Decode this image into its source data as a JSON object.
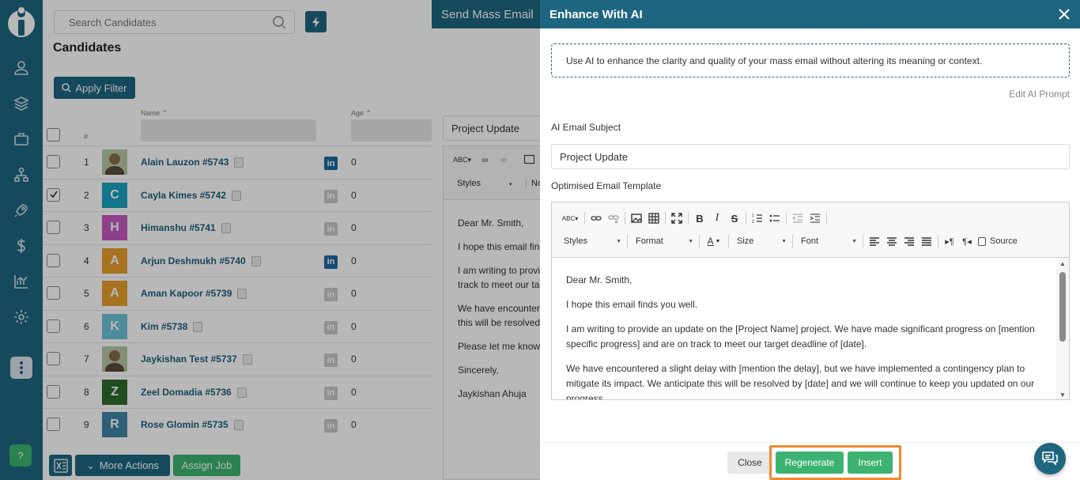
{
  "colors": {
    "primary": "#1e6680",
    "success": "#3cb371",
    "highlight": "#f08a30"
  },
  "rail": {
    "icons": [
      "logo-icon",
      "person-icon",
      "layers-icon",
      "briefcase-icon",
      "org-chart-icon",
      "rocket-icon",
      "dollar-icon",
      "chart-icon",
      "gear-icon",
      "more-icon",
      "help-icon"
    ],
    "help_label": "?"
  },
  "candidates": {
    "search_placeholder": "Search Candidates",
    "title": "Candidates",
    "apply_filter": "Apply Filter",
    "col_name": "Name",
    "col_age": "Age",
    "col_num": "#",
    "rows": [
      {
        "num": "1",
        "name": "Alain Lauzon #5743",
        "avatar": "",
        "avatar_color": "photo",
        "linkedin": true,
        "age": "0",
        "checked": false
      },
      {
        "num": "2",
        "name": "Cayla Kimes #5742",
        "avatar": "C",
        "avatar_color": "#1aa3c0",
        "linkedin": false,
        "age": "0",
        "checked": true
      },
      {
        "num": "3",
        "name": "Himanshu #5741",
        "avatar": "H",
        "avatar_color": "#c659c0",
        "linkedin": false,
        "age": "0",
        "checked": false
      },
      {
        "num": "4",
        "name": "Arjun Deshmukh #5740",
        "avatar": "A",
        "avatar_color": "#e8a02e",
        "linkedin": true,
        "age": "0",
        "checked": false
      },
      {
        "num": "5",
        "name": "Aman Kapoor #5739",
        "avatar": "A",
        "avatar_color": "#e8a02e",
        "linkedin": false,
        "age": "0",
        "checked": false
      },
      {
        "num": "6",
        "name": "Kim #5738",
        "avatar": "K",
        "avatar_color": "#6cc3d8",
        "linkedin": false,
        "age": "0",
        "checked": false
      },
      {
        "num": "7",
        "name": "Jaykishan Test #5737",
        "avatar": "",
        "avatar_color": "photo",
        "linkedin": false,
        "age": "0",
        "checked": false
      },
      {
        "num": "8",
        "name": "Zeel Domadia #5736",
        "avatar": "Z",
        "avatar_color": "#2e6b2e",
        "linkedin": false,
        "age": "0",
        "checked": false
      },
      {
        "num": "9",
        "name": "Rose Glomin #5735",
        "avatar": "R",
        "avatar_color": "#3f86a6",
        "linkedin": false,
        "age": "0",
        "checked": false
      }
    ],
    "more_actions": "More Actions",
    "assign_job": "Assign Job"
  },
  "mass_email": {
    "title": "Send Mass Email",
    "subject": "Project Update",
    "styles_label": "Styles",
    "normal_label": "Nor",
    "body": [
      "Dear Mr. Smith,",
      "I hope this email finds you well.",
      "I am writing to provide an update on the [Project Name] project. We have made significant progress on [mention specific progress] and are on",
      "track to meet our target deadline of [date].",
      "We have encountered a slight delay with [mention the delay], but we have implemented a contingency plan to mitigate its impact. We anticipate",
      "this will be resolved by [date] and we will continue to keep you updated on our progress.",
      "Please let me know if you have any questions.",
      "Sincerely,",
      "Jaykishan Ahuja"
    ]
  },
  "enhance": {
    "title": "Enhance With AI",
    "info": "Use AI to enhance the clarity and quality of your mass email without altering its meaning or context.",
    "edit_prompt": "Edit AI Prompt",
    "subject_label": "AI Email Subject",
    "subject_value": "Project Update",
    "template_label": "Optimised Email Template",
    "toolbar": {
      "styles": "Styles",
      "format": "Format",
      "size": "Size",
      "font": "Font",
      "source": "Source",
      "bold": "B",
      "italic": "I",
      "strike": "S"
    },
    "body": [
      "Dear Mr. Smith,",
      "I hope this email finds you well.",
      "I am writing to provide an update on the [Project Name] project. We have made significant progress on [mention specific progress] and are on track to meet our target deadline of [date].",
      "We have encountered a slight delay with [mention the delay], but we have implemented a contingency plan to mitigate its impact. We anticipate this will be resolved by [date] and we will continue to keep you updated on our progress."
    ],
    "close": "Close",
    "regenerate": "Regenerate",
    "insert": "Insert"
  }
}
